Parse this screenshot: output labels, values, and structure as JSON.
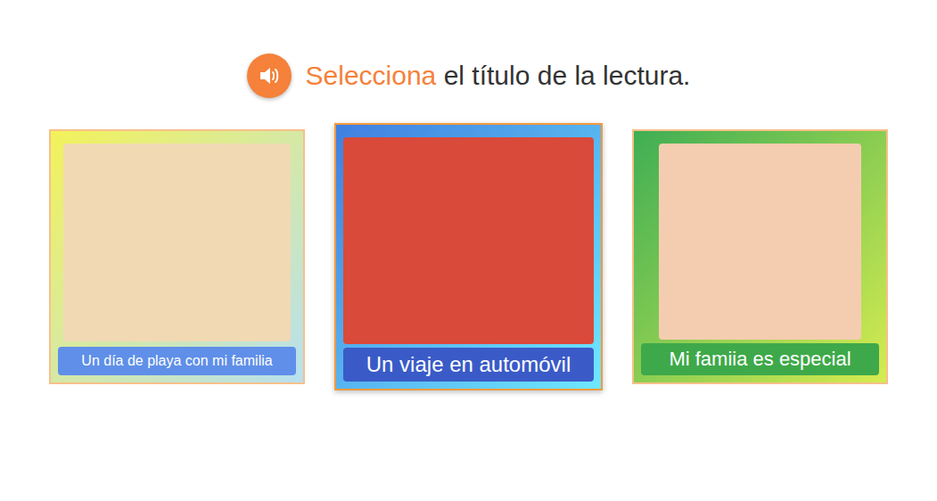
{
  "instruction": {
    "highlight": "Selecciona",
    "rest": " el título de la lectura."
  },
  "options": [
    {
      "title": "Un día de playa con mi familia",
      "selected": false,
      "color": "#5f8fe8"
    },
    {
      "title": "Un viaje en automóvil",
      "selected": true,
      "color": "#3a5bc7"
    },
    {
      "title": "Mi famiia es especial",
      "selected": false,
      "color": "#3ea94a"
    }
  ]
}
